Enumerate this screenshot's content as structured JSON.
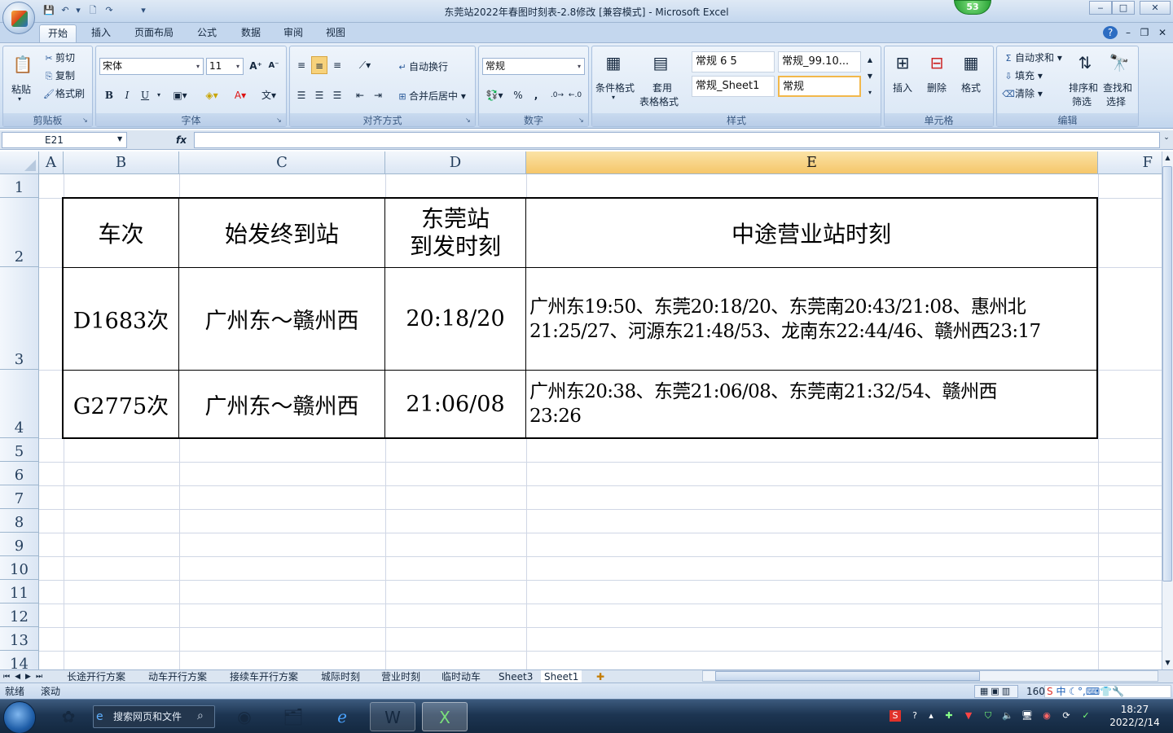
{
  "window": {
    "title": "东莞站2022年春图时刻表-2.8修改  [兼容模式] - Microsoft Excel",
    "badge": "53",
    "min": "‒",
    "max": "□",
    "close": "✕"
  },
  "ribbon_tabs": [
    "开始",
    "插入",
    "页面布局",
    "公式",
    "数据",
    "审阅",
    "视图"
  ],
  "clipboard": {
    "paste": "粘贴",
    "cut": "剪切",
    "copy": "复制",
    "painter": "格式刷",
    "label": "剪贴板"
  },
  "font": {
    "name": "宋体",
    "size": "11",
    "bold": "B",
    "italic": "I",
    "underline": "U",
    "label": "字体"
  },
  "alignment": {
    "wrap": "自动换行",
    "merge": "合并后居中",
    "label": "对齐方式"
  },
  "number": {
    "format": "常规",
    "percent": "%",
    "comma": ",",
    "label": "数字"
  },
  "styles": {
    "conditional": "条件格式",
    "table1": "套用",
    "table2": "表格格式",
    "gallery": [
      "常规 6 5",
      "常规_99.10...",
      "常规_Sheet1",
      "常规"
    ],
    "label": "样式"
  },
  "cells": {
    "insert": "插入",
    "delete": "删除",
    "format": "格式",
    "label": "单元格"
  },
  "editing": {
    "autosum": "自动求和",
    "fill": "填充",
    "clear": "清除",
    "sort1": "排序和",
    "sort2": "筛选",
    "find1": "查找和",
    "find2": "选择",
    "label": "编辑"
  },
  "formula_bar": {
    "name_box": "E21",
    "fx": "fx",
    "value": ""
  },
  "columns": [
    "A",
    "B",
    "C",
    "D",
    "E",
    "F"
  ],
  "rows": [
    "1",
    "2",
    "3",
    "4",
    "5",
    "6",
    "7",
    "8",
    "9",
    "10",
    "11",
    "12",
    "13",
    "14"
  ],
  "table": {
    "headers": [
      "车次",
      "始发终到站",
      "东莞站",
      "到发时刻",
      "中途营业站时刻"
    ],
    "rows": [
      {
        "train": "D1683次",
        "route": "广州东～赣州西",
        "time": "20:18/20",
        "stops_line1": "广州东19:50、东莞20:18/20、东莞南20:43/21:08、惠州北",
        "stops_line2": "21:25/27、河源东21:48/53、龙南东22:44/46、赣州西23:17"
      },
      {
        "train": "G2775次",
        "route": "广州东～赣州西",
        "time": "21:06/08",
        "stops_line1": "广州东20:38、东莞21:06/08、东莞南21:32/54、赣州西",
        "stops_line2": "23:26"
      }
    ]
  },
  "sheet_tabs": [
    "长途开行方案",
    "动车开行方案",
    "接续车开行方案",
    "城际时刻",
    "营业时刻",
    "临时动车",
    "Sheet3",
    "Sheet1"
  ],
  "active_sheet": "Sheet1",
  "status": {
    "ready": "就绪",
    "scroll": "滚动",
    "zoom": "160"
  },
  "taskbar": {
    "search_placeholder": "搜索网页和文件",
    "time": "18:27",
    "date": "2022/2/14",
    "ime": "中"
  }
}
